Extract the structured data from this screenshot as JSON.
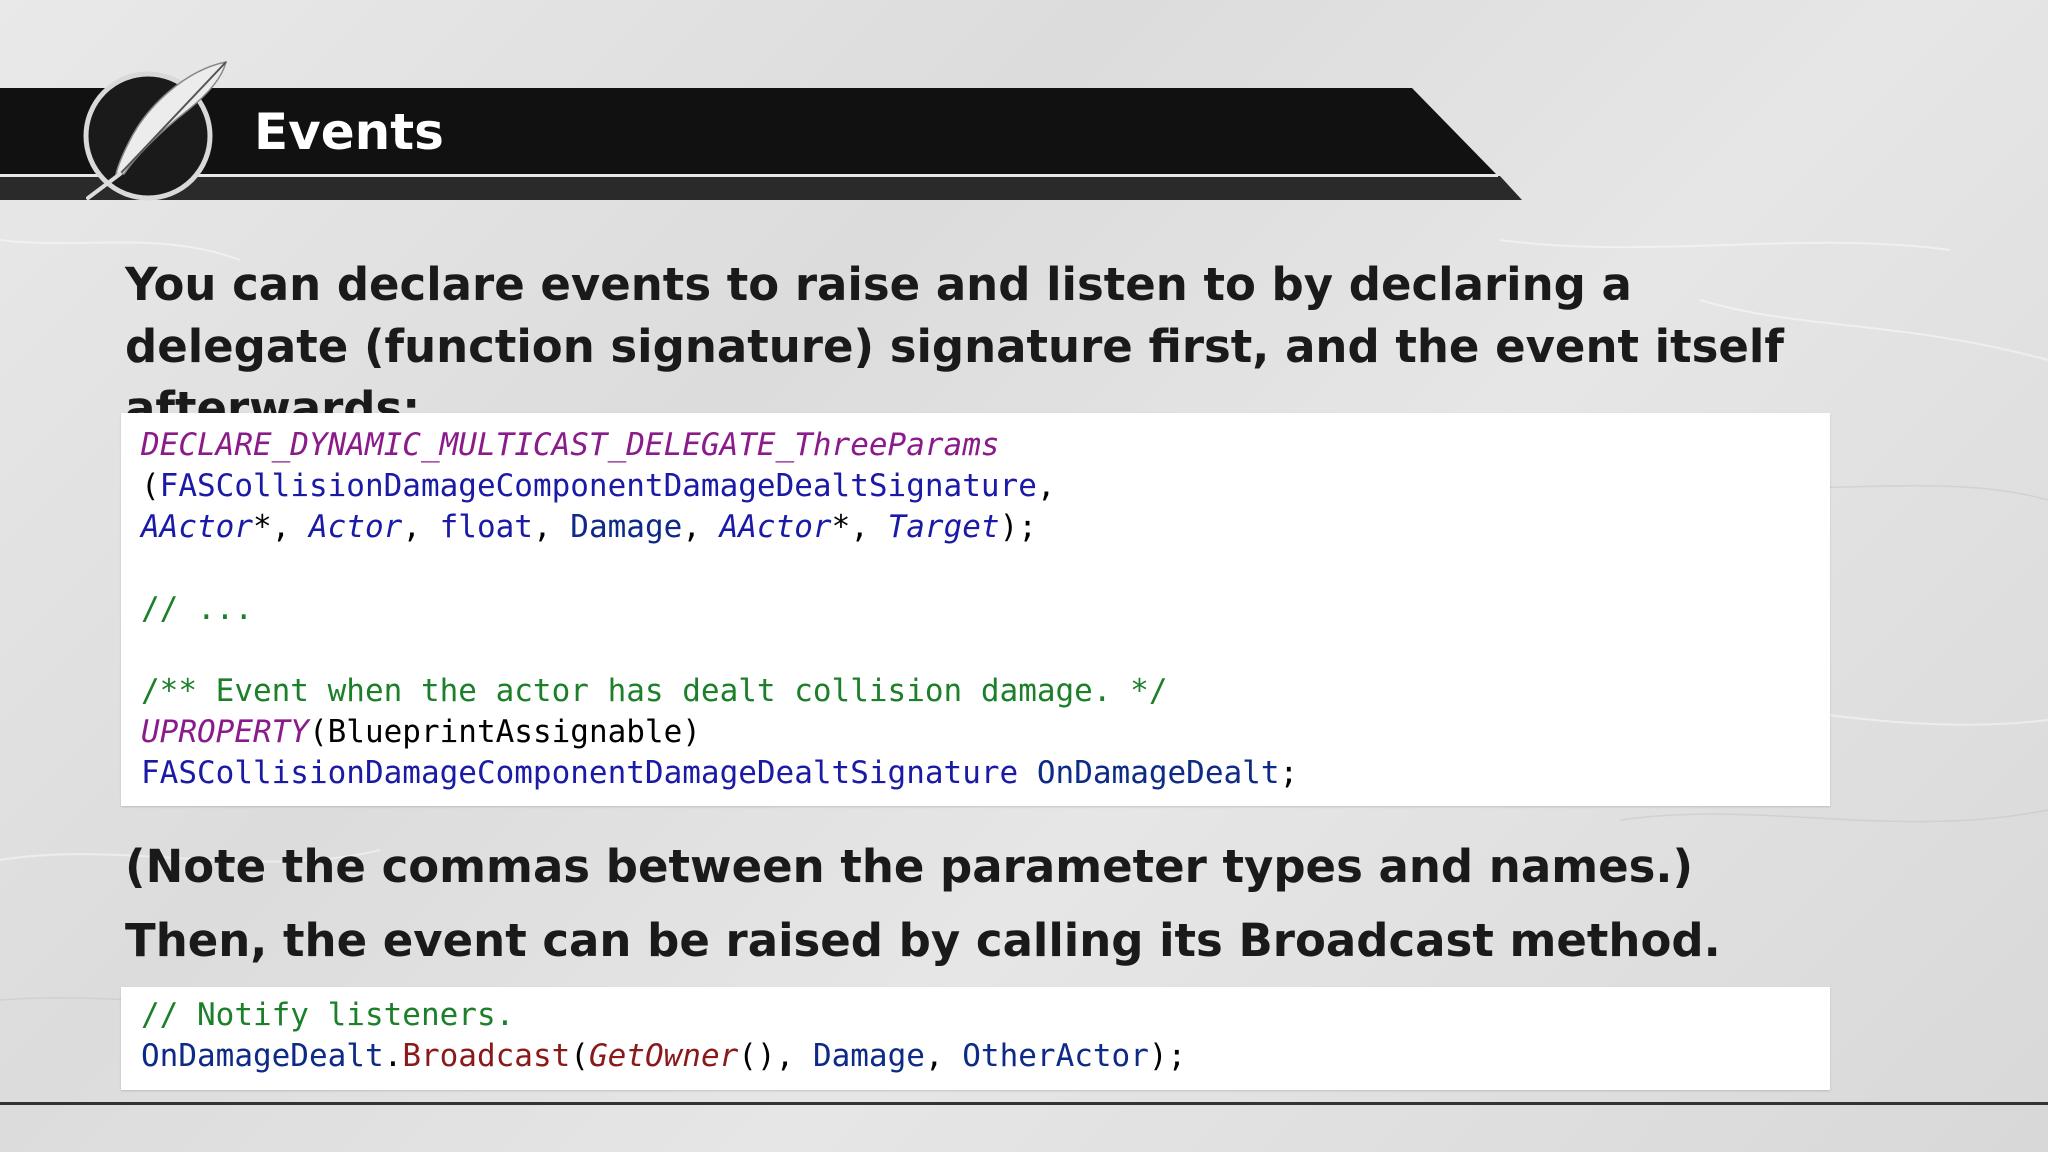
{
  "slide": {
    "title": "Events",
    "logo_icon": "feather-quill-icon",
    "colors": {
      "banner": "#111111",
      "code_keyword": "#8b1a8b",
      "code_type": "#1a1aa6",
      "code_comment": "#1c7f2a",
      "code_method": "#8a1a1a",
      "code_background": "#ffffff"
    },
    "intro_text": "You can declare events to raise and listen to by declaring a delegate (function signature) signature first, and the event itself afterwards:",
    "note_text": "(Note the commas between the parameter types and names.)",
    "then_text": "Then, the event can be raised by calling its Broadcast method."
  },
  "code1": {
    "l1": "DECLARE_DYNAMIC_MULTICAST_DELEGATE_ThreeParams",
    "l2": {
      "open": "(",
      "sig": "FASCollisionDamageComponentDamageDealtSignature",
      "comma": ","
    },
    "l3": {
      "t1": "AActor",
      "p1": "*, ",
      "n1": "Actor",
      "p2": ", ",
      "t2": "float",
      "p3": ", ",
      "n2": "Damage",
      "p4": ", ",
      "t3": "AActor",
      "p5": "*, ",
      "n3": "Target",
      "p6": ");"
    },
    "l5": "// ...",
    "l7": "/** Event when the actor has dealt collision damage. */",
    "l8": {
      "macro": "UPROPERTY",
      "args": "(BlueprintAssignable)"
    },
    "l9": {
      "type": "FASCollisionDamageComponentDamageDealtSignature",
      "space": " ",
      "name": "OnDamageDealt",
      "semi": ";"
    }
  },
  "code2": {
    "l1": "// Notify listeners.",
    "l2": {
      "obj": "OnDamageDealt",
      "dot": ".",
      "method": "Broadcast",
      "open": "(",
      "call": "GetOwner",
      "p1": "(), ",
      "a1": "Damage",
      "p2": ", ",
      "a2": "OtherActor",
      "p3": ");"
    }
  }
}
